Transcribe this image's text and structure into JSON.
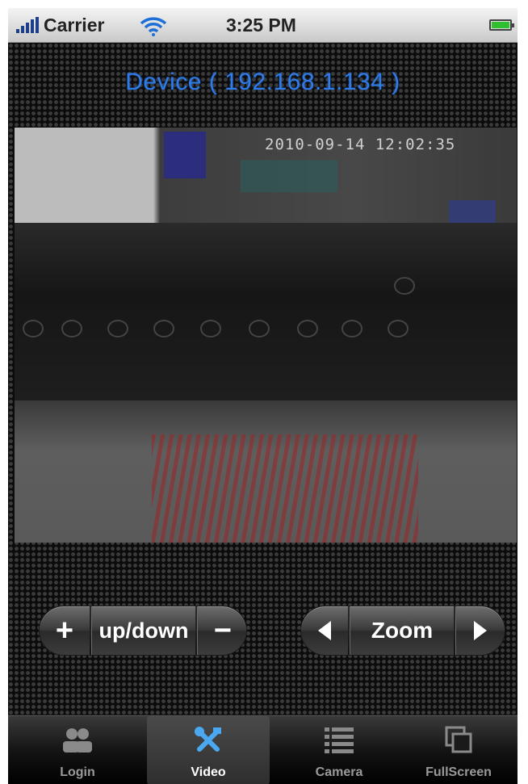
{
  "status_bar": {
    "carrier": "Carrier",
    "time": "3:25 PM",
    "signal_icon": "signal-bars-icon",
    "wifi_icon": "wifi-icon",
    "battery_icon": "battery-icon",
    "battery_level": 1.0
  },
  "header": {
    "title": "Device ( 192.168.1.134 )",
    "title_color": "#2f7ce8"
  },
  "video": {
    "timestamp": "2010-09-14 12:02:35"
  },
  "controls": {
    "updown": {
      "plus_glyph": "+",
      "label": "up/down",
      "minus_glyph": "−"
    },
    "zoom": {
      "left_icon": "triangle-left-icon",
      "label": "Zoom",
      "right_icon": "triangle-right-icon"
    }
  },
  "tab_bar": {
    "active_tab": "Video",
    "tabs": [
      {
        "label": "Login",
        "icon": "users-icon"
      },
      {
        "label": "Video",
        "icon": "tools-icon"
      },
      {
        "label": "Camera",
        "icon": "list-icon"
      },
      {
        "label": "FullScreen",
        "icon": "window-icon"
      }
    ]
  }
}
